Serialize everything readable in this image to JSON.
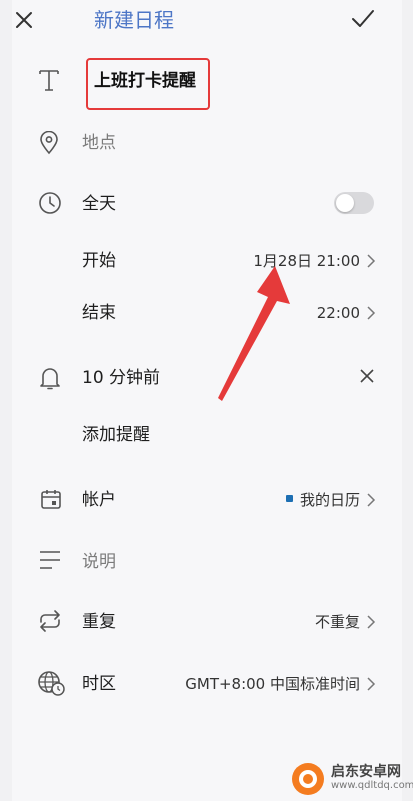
{
  "header": {
    "title": "新建日程",
    "close_icon": "close-icon",
    "confirm_icon": "check-icon"
  },
  "form": {
    "event_title": "上班打卡提醒",
    "location_placeholder": "地点",
    "all_day_label": "全天",
    "all_day_on": false,
    "start_label": "开始",
    "start_value": "1月28日 21:00",
    "end_label": "结束",
    "end_value": "22:00",
    "reminder_label": "10 分钟前",
    "add_reminder_label": "添加提醒",
    "account_label": "帐户",
    "account_value": "我的日历",
    "description_placeholder": "说明",
    "repeat_label": "重复",
    "repeat_value": "不重复",
    "timezone_label": "时区",
    "timezone_value": "GMT+8:00 中国标准时间"
  },
  "colors": {
    "title_blue": "#4d76c6",
    "highlight_red": "#e53a3a",
    "calendar_dot": "#1d6fb3"
  },
  "watermark": {
    "name": "启东安卓网",
    "url": "www.qdltdq.com"
  }
}
